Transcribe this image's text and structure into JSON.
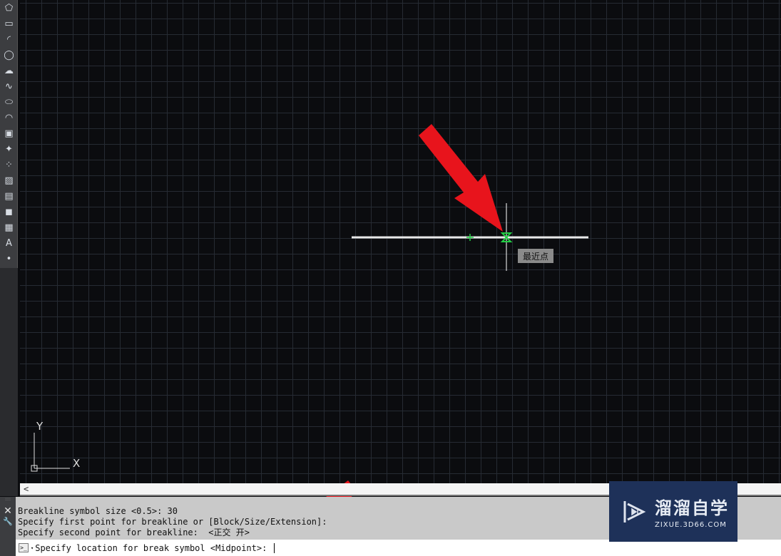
{
  "toolbar": {
    "tools": [
      {
        "icon": "polygon-icon",
        "glyph": "⬠"
      },
      {
        "icon": "rectangle-icon",
        "glyph": "▭"
      },
      {
        "icon": "arc-icon",
        "glyph": "◜"
      },
      {
        "icon": "circle-icon",
        "glyph": "◯"
      },
      {
        "icon": "revcloud-icon",
        "glyph": "☁"
      },
      {
        "icon": "spline-icon",
        "glyph": "∿"
      },
      {
        "icon": "ellipse-icon",
        "glyph": "⬭"
      },
      {
        "icon": "ellipse-arc-icon",
        "glyph": "◠"
      },
      {
        "icon": "insert-block-icon",
        "glyph": "▣"
      },
      {
        "icon": "make-block-icon",
        "glyph": "✦"
      },
      {
        "icon": "point-icon",
        "glyph": "⁘"
      },
      {
        "icon": "hatch-icon",
        "glyph": "▨"
      },
      {
        "icon": "gradient-icon",
        "glyph": "▤"
      },
      {
        "icon": "region-icon",
        "glyph": "◼"
      },
      {
        "icon": "table-icon",
        "glyph": "▦"
      },
      {
        "icon": "multiline-text-icon",
        "glyph": "A"
      },
      {
        "icon": "add-selected-icon",
        "glyph": "•"
      }
    ]
  },
  "canvas": {
    "tooltip": "最近点",
    "ucs_x": "X",
    "ucs_y": "Y",
    "arrow_color": "#e8141c",
    "snap_color": "#22cc44"
  },
  "scrollbar": {
    "left_arrow": "<"
  },
  "command": {
    "close": "✕",
    "settings": "🔧",
    "history": [
      "Breakline symbol size <0.5>: 30",
      "Specify first point for breakline or [Block/Size/Extension]:",
      "Specify second point for breakline:  <正交 开>"
    ],
    "prompt_icon": ">_",
    "prompt": "Specify location for break symbol <Midpoint>: "
  },
  "watermark": {
    "name": "溜溜自学",
    "url": "ZIXUE.3D66.COM"
  }
}
